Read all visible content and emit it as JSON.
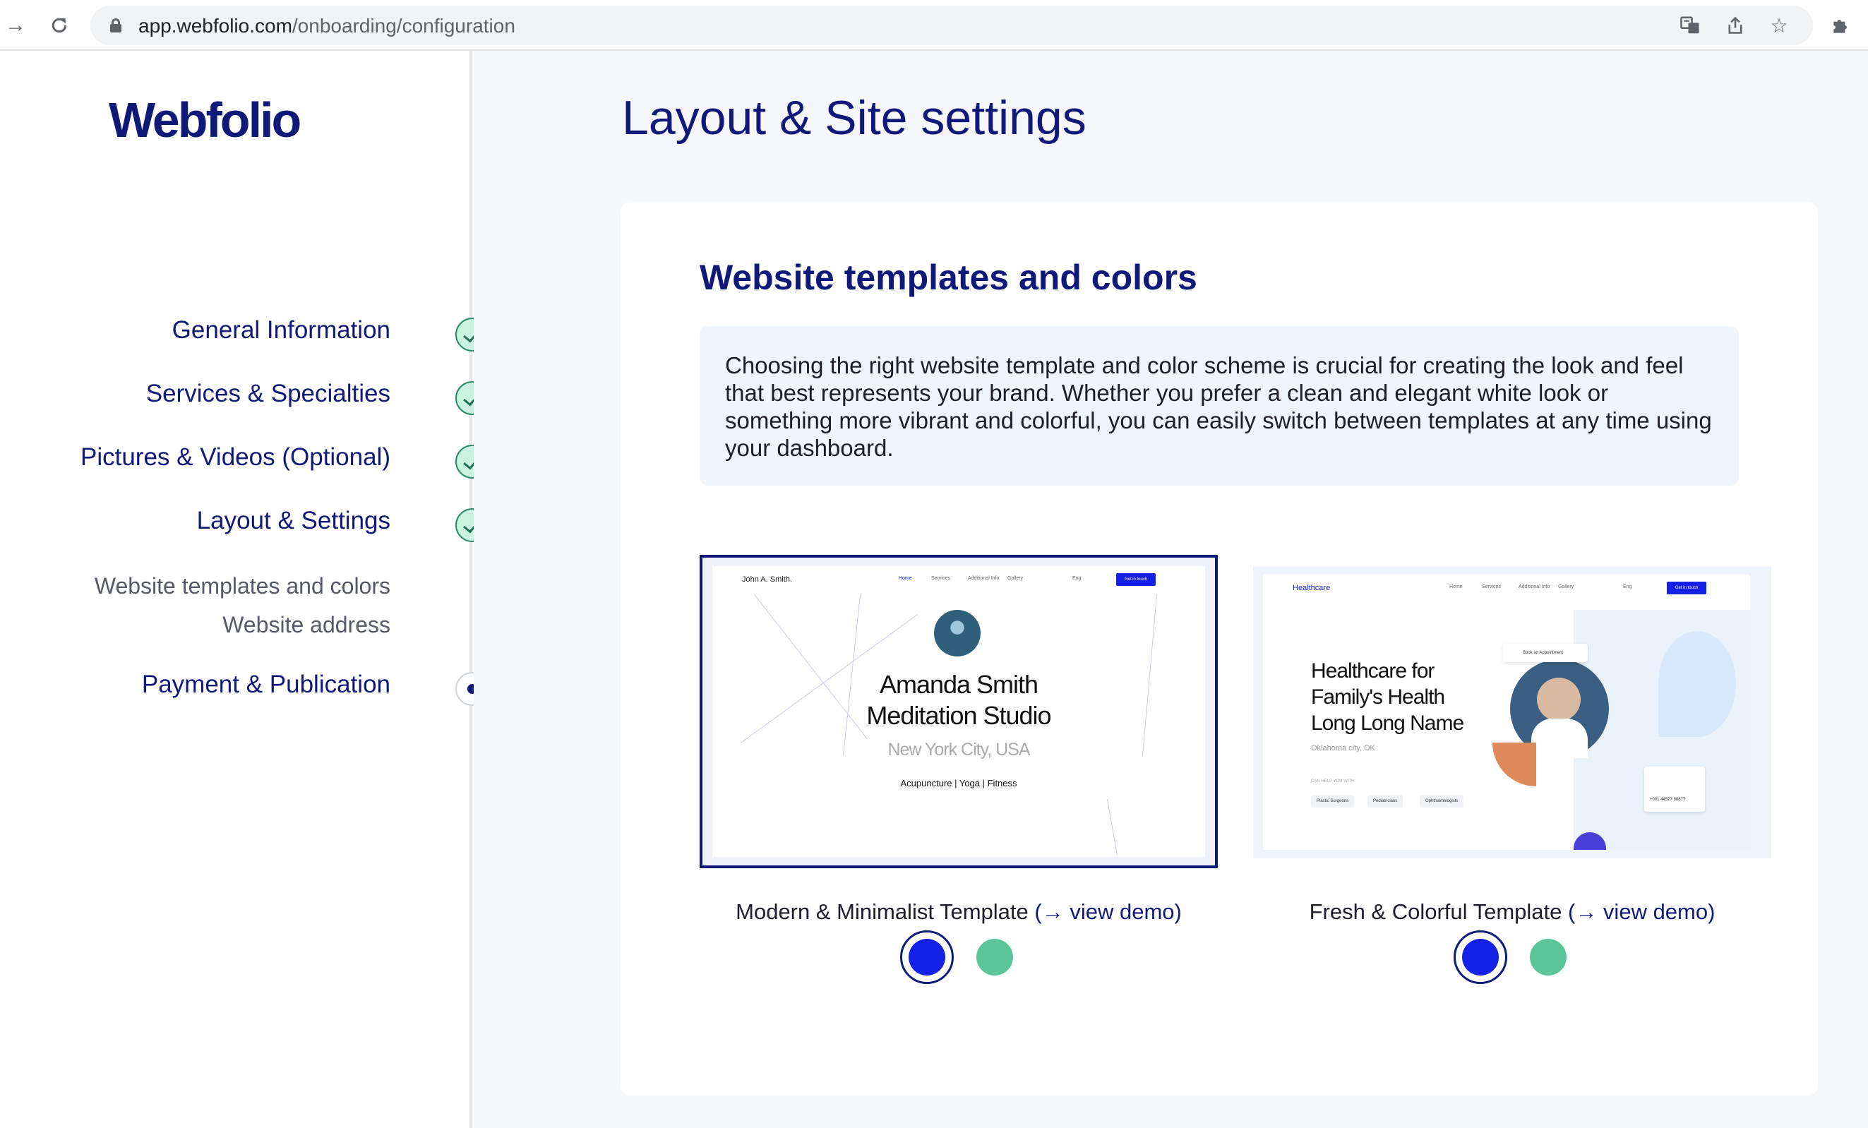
{
  "browser": {
    "url_host": "app.webfolio.com",
    "url_path": "/onboarding/configuration"
  },
  "sidebar": {
    "logo": "Webfolio",
    "steps": [
      {
        "label": "General Information",
        "status": "done"
      },
      {
        "label": "Services & Specialties",
        "status": "done"
      },
      {
        "label": "Pictures & Videos (Optional)",
        "status": "done"
      },
      {
        "label": "Layout & Settings",
        "status": "done"
      },
      {
        "label": "Payment & Publication",
        "status": "current"
      }
    ],
    "substeps": [
      "Website templates and colors",
      "Website address"
    ]
  },
  "main": {
    "page_title": "Layout & Site settings",
    "section_title": "Website templates and colors",
    "description": "Choosing the right website template and color scheme is crucial for creating the look and feel that best represents your brand. Whether you prefer a clean and elegant white look or something more vibrant and colorful, you can easily switch between templates at any time using your dashboard.",
    "templates": [
      {
        "name": "Modern & Minimalist Template",
        "demo_link": "(→ view demo)",
        "selected": true,
        "preview": {
          "brand": "John A. Smith.",
          "nav": [
            "Home",
            "Services",
            "Additional Info",
            "Gallery"
          ],
          "lang": "Eng",
          "cta": "Get in touch",
          "title_line1": "Amanda Smith",
          "title_line2": "Meditation Studio",
          "location": "New York City, USA",
          "tags": "Acupuncture | Yoga | Fitness"
        },
        "colors": [
          "#1420e6",
          "#5bc49a"
        ]
      },
      {
        "name": "Fresh & Colorful Template",
        "demo_link": "(→ view demo)",
        "selected": false,
        "preview": {
          "brand": "Healthcare",
          "nav": [
            "Home",
            "Services",
            "Additional Info",
            "Gallery"
          ],
          "lang": "Eng",
          "cta": "Get in touch",
          "title_line1": "Healthcare for",
          "title_line2": "Family's Health",
          "title_line3": "Long Long Name",
          "location": "Oklahoma city, OK",
          "help_label": "CAN HELP YOU WITH",
          "chips": [
            "Plastic Surgeons",
            "Pediatricians",
            "Ophthalmologists"
          ],
          "appointment": "Book an Appointment",
          "phone": "+001 44577 88877"
        },
        "colors": [
          "#1420e6",
          "#5bc49a"
        ]
      }
    ]
  },
  "colors": {
    "brand_navy": "#10197a",
    "accent_blue": "#1420e6",
    "accent_green": "#5bc49a",
    "info_bg": "#eef5fd",
    "check_bg": "#c9f2e0"
  }
}
